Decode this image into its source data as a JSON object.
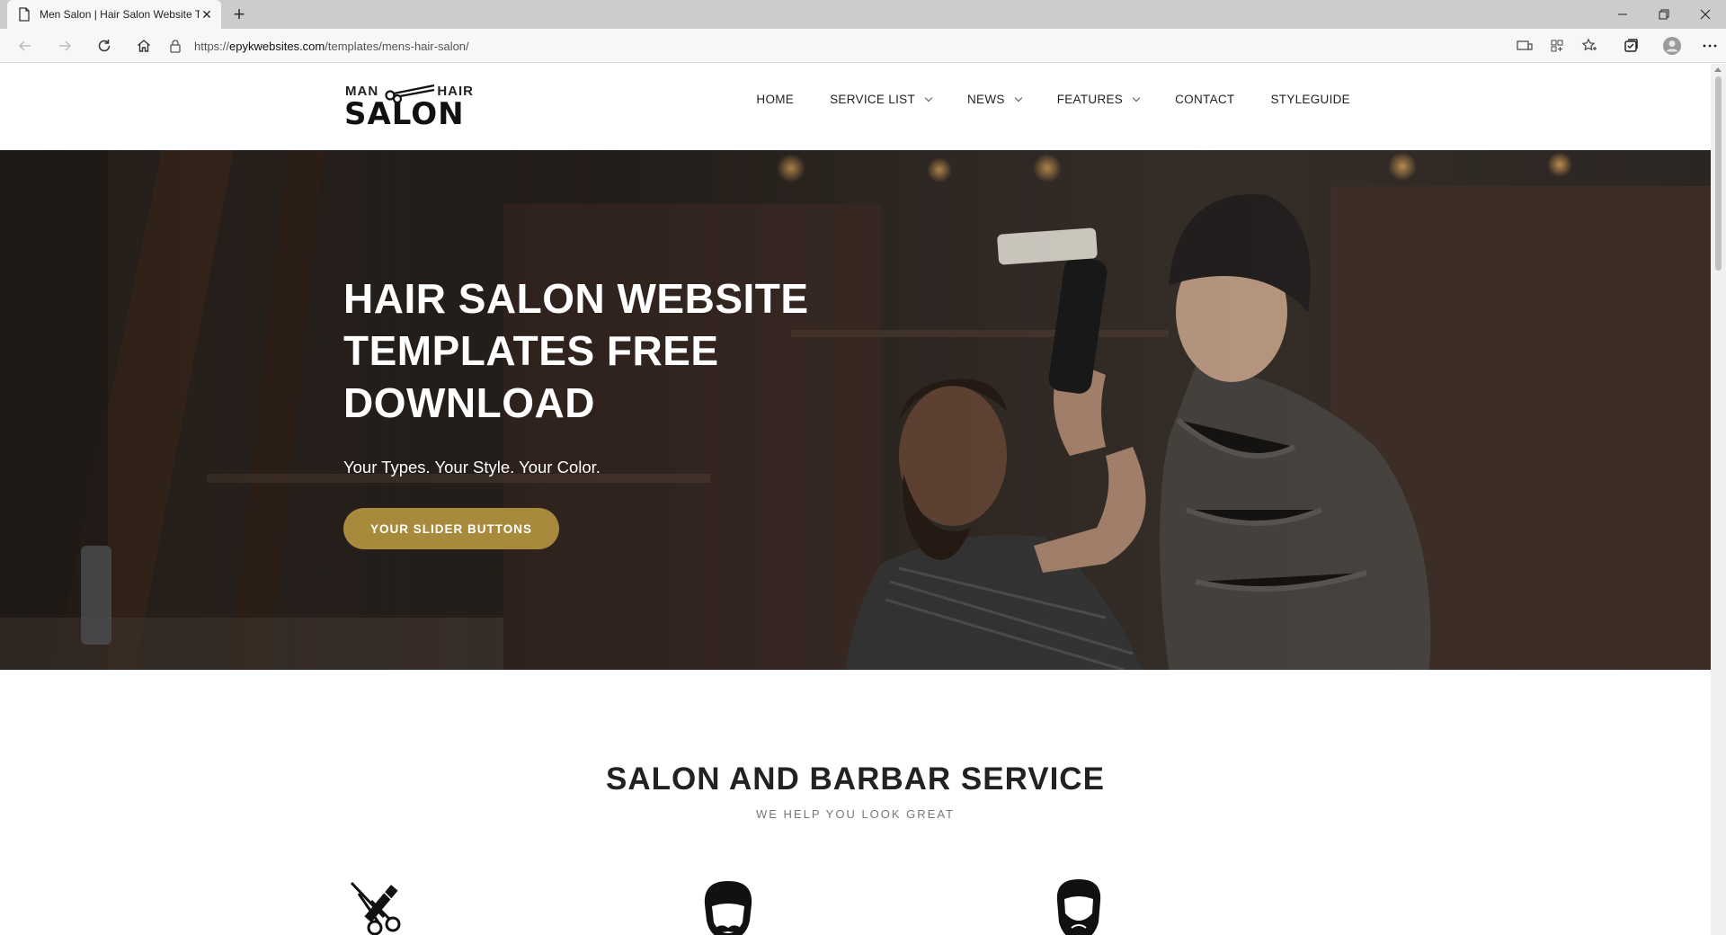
{
  "browser": {
    "tab_title": "Men Salon | Hair Salon Website T",
    "url_scheme": "https://",
    "url_host": "epykwebsites.com",
    "url_path": "/templates/mens-hair-salon/"
  },
  "logo": {
    "top_left": "MAN",
    "top_right": "HAIR",
    "main": "SALON"
  },
  "nav": {
    "items": [
      {
        "label": "HOME",
        "dropdown": false
      },
      {
        "label": "SERVICE LIST",
        "dropdown": true
      },
      {
        "label": "NEWS",
        "dropdown": true
      },
      {
        "label": "FEATURES",
        "dropdown": true
      },
      {
        "label": "CONTACT",
        "dropdown": false
      },
      {
        "label": "STYLEGUIDE",
        "dropdown": false
      }
    ]
  },
  "hero": {
    "title": "HAIR SALON WEBSITE TEMPLATES FREE DOWNLOAD",
    "subtitle": "Your Types. Your Style. Your Color.",
    "button_label": "YOUR SLIDER BUTTONS"
  },
  "services": {
    "title": "SALON AND BARBAR SERVICE",
    "subtitle": "WE HELP YOU LOOK GREAT",
    "icons": [
      "scissors-comb-icon",
      "mustache-man-icon",
      "bearded-man-icon"
    ]
  },
  "colors": {
    "accent": "#a88a3c",
    "text_dark": "#222222"
  }
}
